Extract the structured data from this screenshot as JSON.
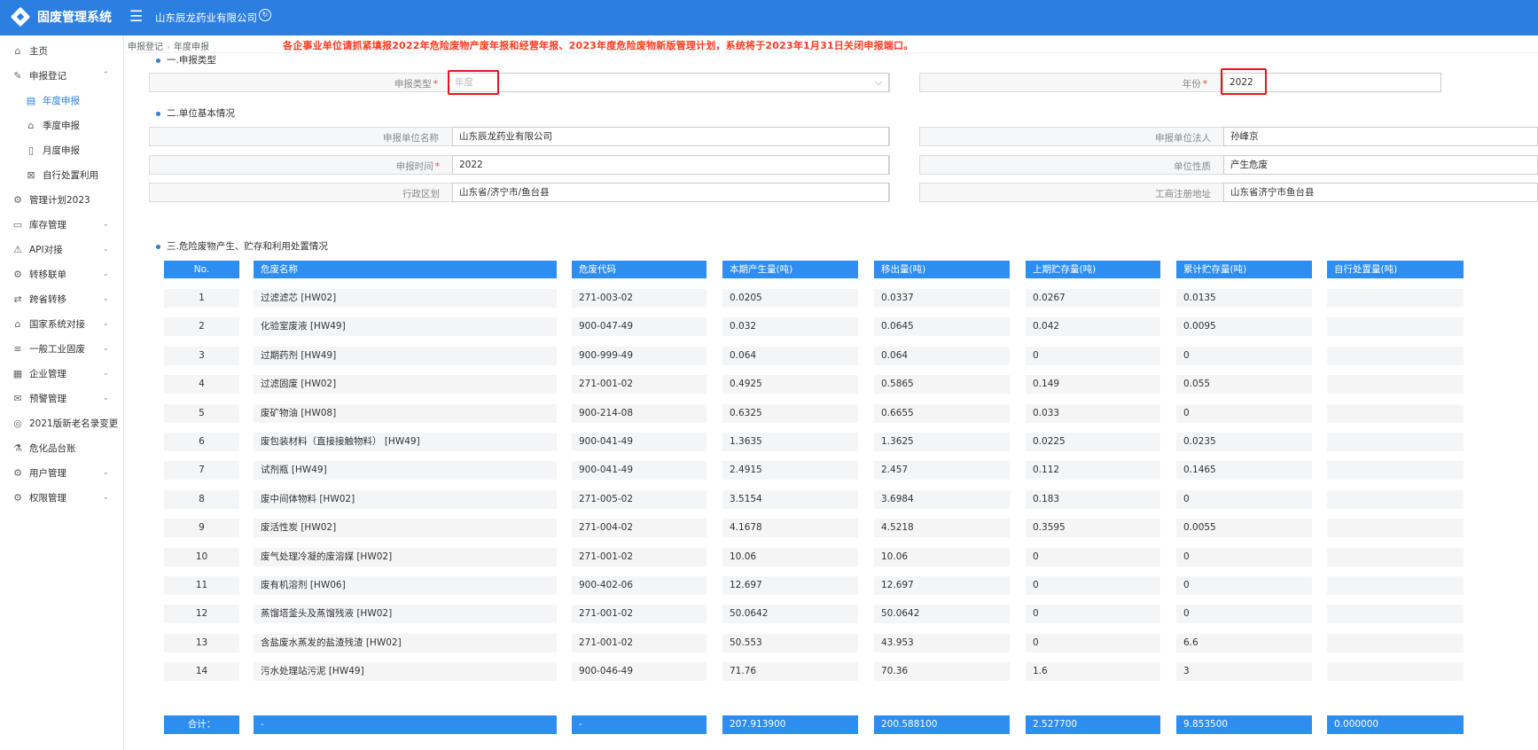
{
  "header": {
    "brand": "固废管理系统",
    "company": "山东辰龙药业有限公司"
  },
  "sidebar": {
    "items": [
      {
        "label": "主页",
        "icon": "home-icon"
      },
      {
        "label": "申报登记",
        "icon": "edit-icon",
        "expanded": true
      },
      {
        "label": "年度申报",
        "icon": "calendar-icon",
        "active": true
      },
      {
        "label": "季度申报",
        "icon": "house-icon"
      },
      {
        "label": "月度申报",
        "icon": "document-icon"
      },
      {
        "label": "自行处置利用",
        "icon": "grid-icon"
      },
      {
        "label": "管理计划2023",
        "icon": "gear-plan-icon"
      },
      {
        "label": "库存管理",
        "icon": "box-icon"
      },
      {
        "label": "API对接",
        "icon": "warning-icon"
      },
      {
        "label": "转移联单",
        "icon": "transfer-icon"
      },
      {
        "label": "跨省转移",
        "icon": "route-icon"
      },
      {
        "label": "国家系统对接",
        "icon": "building-icon"
      },
      {
        "label": "一般工业固废",
        "icon": "list-icon"
      },
      {
        "label": "企业管理",
        "icon": "apps-icon"
      },
      {
        "label": "预警管理",
        "icon": "mail-icon"
      },
      {
        "label": "2021版新老名录变更",
        "icon": "badge-icon"
      },
      {
        "label": "危化品台账",
        "icon": "flask-icon"
      },
      {
        "label": "用户管理",
        "icon": "user-gear-icon"
      },
      {
        "label": "权限管理",
        "icon": "lock-gear-icon"
      }
    ]
  },
  "breadcrumb": {
    "level1": "申报登记",
    "level2": "年度申报"
  },
  "notice": "各企事业单位请抓紧填报2022年危险废物产废年报和经营年报、2023年度危险废物新版管理计划，系统将于2023年1月31日关闭申报端口。",
  "section1": {
    "title": "一.申报类型",
    "type_label": "申报类型",
    "type_placeholder": "年度",
    "year_label": "年份",
    "year_value": "2022"
  },
  "section2": {
    "title": "二.单位基本情况",
    "unit_name_label": "申报单位名称",
    "unit_name_value": "山东辰龙药业有限公司",
    "legal_label": "申报单位法人",
    "legal_value": "孙峰京",
    "time_label": "申报时间",
    "time_value": "2022",
    "nature_label": "单位性质",
    "nature_value": "产生危废",
    "region_label": "行政区划",
    "region_value": "山东省/济宁市/鱼台县",
    "address_label": "工商注册地址",
    "address_value": "山东省济宁市鱼台县"
  },
  "section3": {
    "title": "三.危险废物产生、贮存和利用处置情况",
    "columns": [
      "No.",
      "危废名称",
      "危废代码",
      "本期产生量(吨)",
      "移出量(吨)",
      "上期贮存量(吨)",
      "累计贮存量(吨)",
      "自行处置量(吨)"
    ],
    "rows": [
      [
        "1",
        "过滤滤芯 [HW02]",
        "271-003-02",
        "0.0205",
        "0.0337",
        "0.0267",
        "0.0135",
        ""
      ],
      [
        "2",
        "化验室废液 [HW49]",
        "900-047-49",
        "0.032",
        "0.0645",
        "0.042",
        "0.0095",
        ""
      ],
      [
        "3",
        "过期药剂 [HW49]",
        "900-999-49",
        "0.064",
        "0.064",
        "0",
        "0",
        ""
      ],
      [
        "4",
        "过滤固废 [HW02]",
        "271-001-02",
        "0.4925",
        "0.5865",
        "0.149",
        "0.055",
        ""
      ],
      [
        "5",
        "废矿物油 [HW08]",
        "900-214-08",
        "0.6325",
        "0.6655",
        "0.033",
        "0",
        ""
      ],
      [
        "6",
        "废包装材料（直接接触物料） [HW49]",
        "900-041-49",
        "1.3635",
        "1.3625",
        "0.0225",
        "0.0235",
        ""
      ],
      [
        "7",
        "试剂瓶 [HW49]",
        "900-041-49",
        "2.4915",
        "2.457",
        "0.112",
        "0.1465",
        ""
      ],
      [
        "8",
        "废中间体物料 [HW02]",
        "271-005-02",
        "3.5154",
        "3.6984",
        "0.183",
        "0",
        ""
      ],
      [
        "9",
        "废活性炭 [HW02]",
        "271-004-02",
        "4.1678",
        "4.5218",
        "0.3595",
        "0.0055",
        ""
      ],
      [
        "10",
        "废气处理冷凝的废溶媒 [HW02]",
        "271-001-02",
        "10.06",
        "10.06",
        "0",
        "0",
        ""
      ],
      [
        "11",
        "废有机溶剂 [HW06]",
        "900-402-06",
        "12.697",
        "12.697",
        "0",
        "0",
        ""
      ],
      [
        "12",
        "蒸馏塔釜头及蒸馏残液 [HW02]",
        "271-001-02",
        "50.0642",
        "50.0642",
        "0",
        "0",
        ""
      ],
      [
        "13",
        "含盐废水蒸发的盐渣残渣 [HW02]",
        "271-001-02",
        "50.553",
        "43.953",
        "0",
        "6.6",
        ""
      ],
      [
        "14",
        "污水处理站污泥 [HW49]",
        "900-046-49",
        "71.76",
        "70.36",
        "1.6",
        "3",
        ""
      ]
    ],
    "totals": [
      "合计：",
      "-",
      "-",
      "207.913900",
      "200.588100",
      "2.527700",
      "9.853500",
      "0.000000"
    ]
  }
}
